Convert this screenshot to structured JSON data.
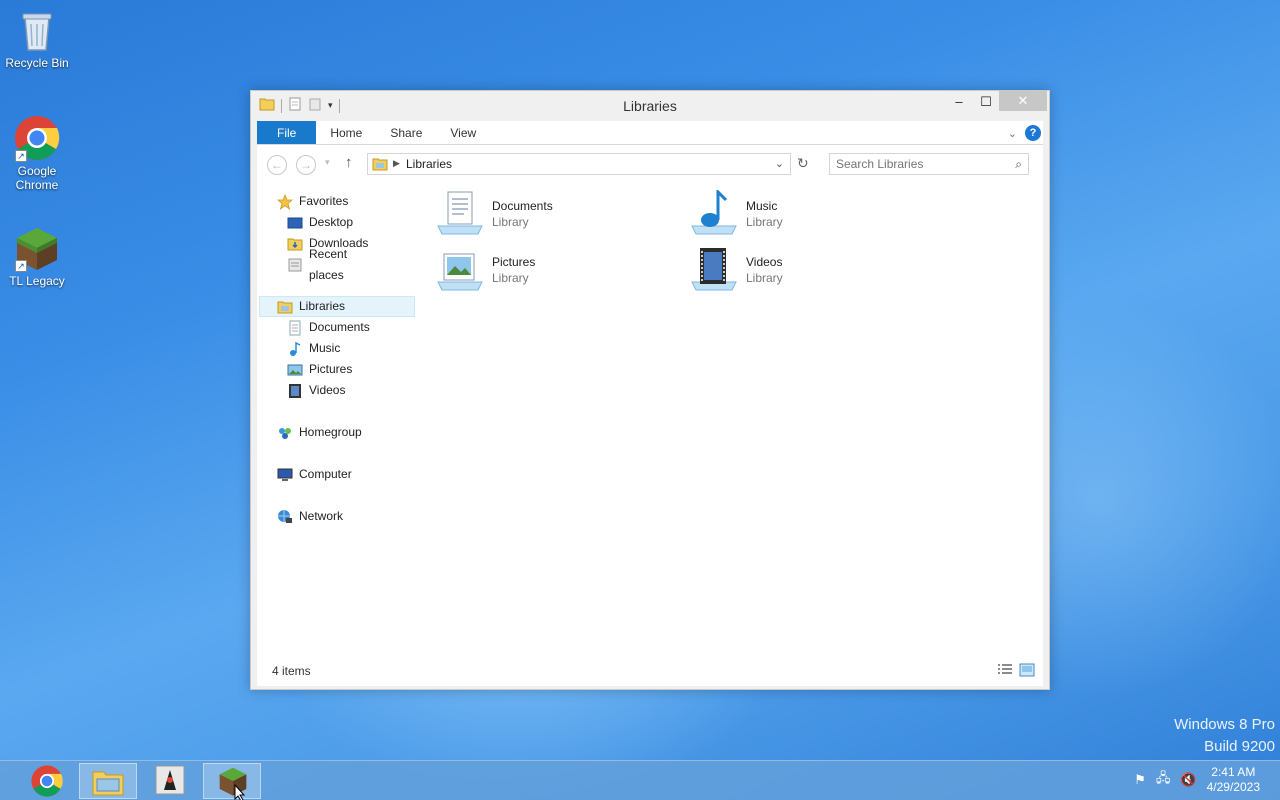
{
  "desktop": {
    "icons": [
      {
        "label": "Recycle Bin"
      },
      {
        "label": "Google Chrome"
      },
      {
        "label": "TL Legacy"
      }
    ],
    "watermark": {
      "line1": "Windows 8 Pro",
      "line2": "Build 9200"
    }
  },
  "window": {
    "title": "Libraries",
    "controls": {
      "minimize": "–",
      "maximize": "☐",
      "close": "✕"
    },
    "ribbon": {
      "tabs": [
        "File",
        "Home",
        "Share",
        "View"
      ],
      "help": "?"
    },
    "address": {
      "path": "Libraries",
      "search_placeholder": "Search Libraries"
    },
    "nav": {
      "favorites": {
        "label": "Favorites",
        "items": [
          "Desktop",
          "Downloads",
          "Recent places"
        ]
      },
      "libraries": {
        "label": "Libraries",
        "items": [
          "Documents",
          "Music",
          "Pictures",
          "Videos"
        ]
      },
      "homegroup": "Homegroup",
      "computer": "Computer",
      "network": "Network"
    },
    "items": [
      {
        "name": "Documents",
        "type": "Library",
        "icon": "documents-library-icon"
      },
      {
        "name": "Music",
        "type": "Library",
        "icon": "music-library-icon"
      },
      {
        "name": "Pictures",
        "type": "Library",
        "icon": "pictures-library-icon"
      },
      {
        "name": "Videos",
        "type": "Library",
        "icon": "videos-library-icon"
      }
    ],
    "status": {
      "count": "4 items"
    }
  },
  "taskbar": {
    "clock": {
      "time": "2:41 AM",
      "date": "4/29/2023"
    }
  },
  "colors": {
    "accent": "#1979ca",
    "selection": "#e5f3fb"
  }
}
